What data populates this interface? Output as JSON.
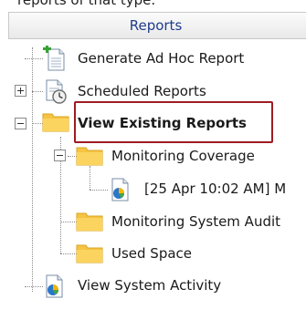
{
  "top_fragment": "reports of that type.",
  "panel": {
    "title": "Reports"
  },
  "tree": {
    "generate_adhoc": "Generate Ad Hoc Report",
    "scheduled_reports": "Scheduled Reports",
    "view_existing": "View Existing Reports",
    "monitoring_coverage": "Monitoring Coverage",
    "report_instance": "[25 Apr 10:02 AM] M",
    "monitoring_system_audit": "Monitoring System Audit",
    "used_space": "Used Space",
    "view_system_activity": "View System Activity"
  },
  "icons": {
    "generate_adhoc": "document-add-icon",
    "scheduled_reports": "document-clock-icon",
    "folder": "folder-icon",
    "report": "report-chart-icon",
    "toggle_expanded": "minus-icon",
    "toggle_collapsed": "plus-icon"
  },
  "colors": {
    "highlight": "#9e1b22",
    "header_text": "#1f3b8c",
    "folder": "#f7c948"
  }
}
